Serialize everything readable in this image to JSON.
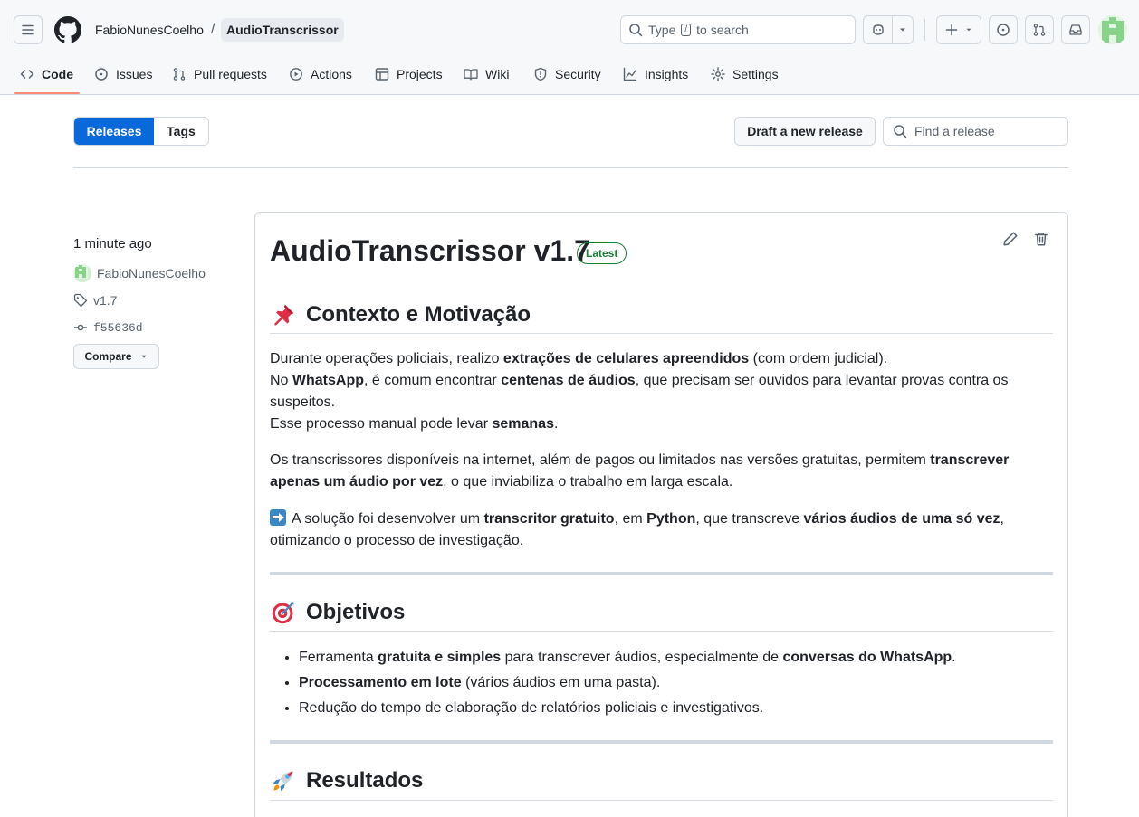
{
  "header": {
    "owner": "FabioNunesCoelho",
    "separator": "/",
    "repo": "AudioTranscrissor",
    "search": {
      "prefix": "Type",
      "key": "/",
      "suffix": "to search"
    }
  },
  "tabs": [
    {
      "label": "Code",
      "icon": "code-icon"
    },
    {
      "label": "Issues",
      "icon": "issue-icon"
    },
    {
      "label": "Pull requests",
      "icon": "pull-request-icon"
    },
    {
      "label": "Actions",
      "icon": "play-icon"
    },
    {
      "label": "Projects",
      "icon": "table-icon"
    },
    {
      "label": "Wiki",
      "icon": "book-icon"
    },
    {
      "label": "Security",
      "icon": "shield-icon"
    },
    {
      "label": "Insights",
      "icon": "graph-icon"
    },
    {
      "label": "Settings",
      "icon": "gear-icon"
    }
  ],
  "subnav": {
    "releases": "Releases",
    "tags": "Tags",
    "draft": "Draft a new release",
    "find_placeholder": "Find a release"
  },
  "sidebar": {
    "time": "1 minute ago",
    "author": "FabioNunesCoelho",
    "tag": "v1.7",
    "commit": "f55636d",
    "compare": "Compare"
  },
  "release": {
    "title": "AudioTranscrissor v1.7",
    "badge": "Latest",
    "sections": {
      "contexto": {
        "title": "Contexto e Motivação",
        "p1": {
          "a": "Durante operações policiais, realizo ",
          "b": "extrações de celulares apreendidos",
          "c": " (com ordem judicial).",
          "d": "No ",
          "e": "WhatsApp",
          "f": ", é comum encontrar ",
          "g": "centenas de áudios",
          "h": ", que precisam ser ouvidos para levantar provas contra os suspeitos.",
          "i": "Esse processo manual pode levar ",
          "j": "semanas",
          "k": "."
        },
        "p2": {
          "a": "Os transcrissores disponíveis na internet, além de pagos ou limitados nas versões gratuitas, permitem ",
          "b": "transcrever apenas um áudio por vez",
          "c": ", o que inviabiliza o trabalho em larga escala."
        },
        "p3": {
          "a": "A solução foi desenvolver um ",
          "b": "transcritor gratuito",
          "c": ", em ",
          "d": "Python",
          "e": ", que transcreve ",
          "f": "vários áudios de uma só vez",
          "g": ", otimizando o processo de investigação."
        }
      },
      "objetivos": {
        "title": "Objetivos",
        "li1": {
          "a": "Ferramenta ",
          "b": "gratuita e simples",
          "c": " para transcrever áudios, especialmente de ",
          "d": "conversas do WhatsApp",
          "e": "."
        },
        "li2": {
          "a": "Processamento em lote",
          "b": " (vários áudios em uma pasta)."
        },
        "li3": {
          "a": "Redução do tempo de elaboração de relatórios policiais e investigativos."
        }
      },
      "resultados": {
        "title": "Resultados"
      }
    }
  },
  "colors": {
    "accent": "#0969da",
    "latest": "#1a7f37",
    "tab_underline": "#fd8c73"
  }
}
